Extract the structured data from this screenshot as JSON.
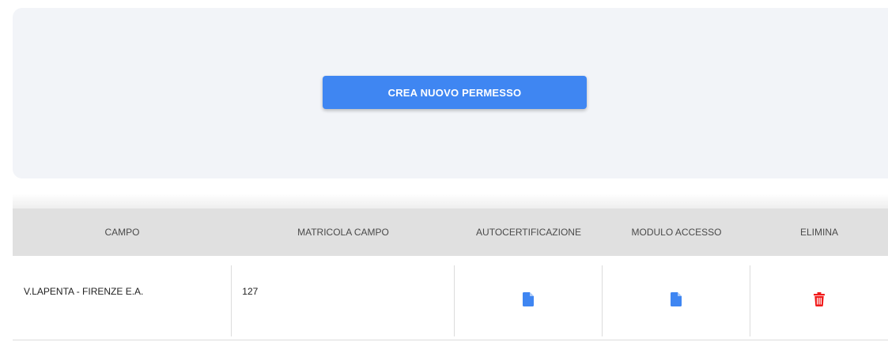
{
  "actions": {
    "create_label": "CREA NUOVO PERMESSO"
  },
  "table": {
    "headers": [
      "CAMPO",
      "MATRICOLA CAMPO",
      "AUTOCERTIFICAZIONE",
      "MODULO ACCESSO",
      "ELIMINA"
    ],
    "rows": [
      {
        "campo": "V.LAPENTA - FIRENZE E.A.",
        "matricola": "127",
        "autocertificazione_icon": "document-icon",
        "modulo_accesso_icon": "document-icon",
        "elimina_icon": "trash-icon"
      }
    ]
  },
  "colors": {
    "primary": "#3f86f2",
    "danger": "#f11b1b",
    "header_bg": "#e0e0e0",
    "card_bg": "#f2f4f8"
  }
}
